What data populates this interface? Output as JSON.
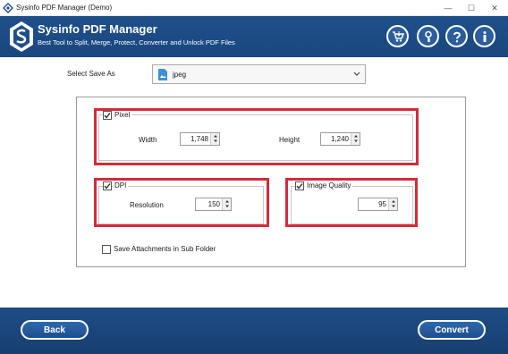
{
  "window": {
    "title": "Sysinfo PDF Manager (Demo)",
    "minimize_glyph": "—",
    "maximize_glyph": "☐",
    "close_glyph": "✕"
  },
  "header": {
    "brand": "Sysinfo PDF Manager",
    "tagline": "Best Tool to Split, Merge, Protect, Converter and Unlock PDF Files",
    "buttons": [
      "cart-icon",
      "key-icon",
      "help-icon",
      "info-icon"
    ],
    "accent_color": "#1f4f8a"
  },
  "save_as": {
    "label": "Select Save As",
    "value": "jpeg"
  },
  "pixel": {
    "label": "Pixel",
    "checked": true,
    "width_label": "Width",
    "width_value": "1,748",
    "height_label": "Height",
    "height_value": "1,240"
  },
  "dpi": {
    "label": "DPI",
    "checked": true,
    "resolution_label": "Resolution",
    "resolution_value": "150"
  },
  "image_quality": {
    "label": "Image Quality",
    "checked": true,
    "value": "95"
  },
  "attachments": {
    "label": "Save Attachments in Sub Folder",
    "checked": false
  },
  "footer": {
    "back_label": "Back",
    "convert_label": "Convert"
  },
  "highlight_color": "#d52b3a"
}
